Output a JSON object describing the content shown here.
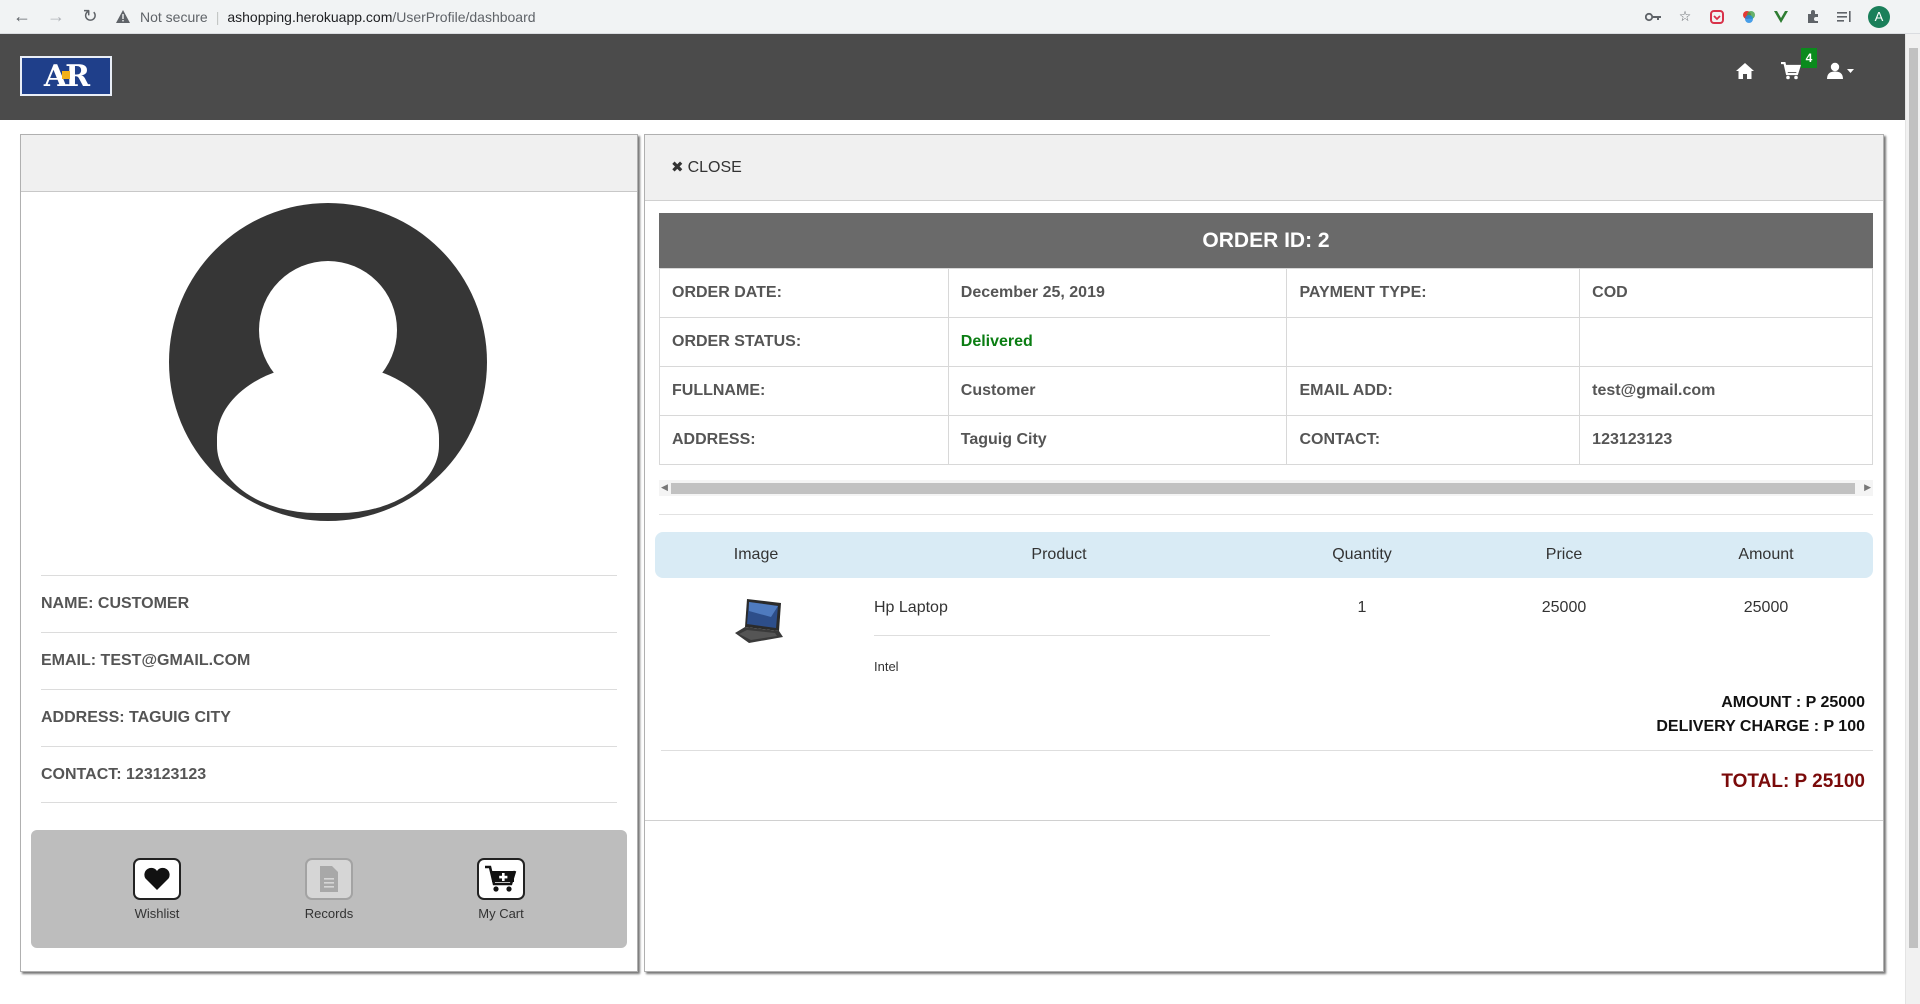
{
  "browser": {
    "security_label": "Not secure",
    "url_host": "ashopping.herokuapp.com",
    "url_path": "/UserProfile/dashboard",
    "profile_initial": "A"
  },
  "header": {
    "logo_text": "AR",
    "cart_count": "4",
    "colors": {
      "background": "#4b4b4b",
      "badge": "#0b8a1d"
    }
  },
  "profile": {
    "name": "NAME: CUSTOMER",
    "email": "EMAIL: TEST@GMAIL.COM",
    "address": "ADDRESS: TAGUIG CITY",
    "contact": "CONTACT: 123123123",
    "actions": {
      "wishlist": "Wishlist",
      "records": "Records",
      "cart": "My Cart"
    }
  },
  "order": {
    "close_label": "CLOSE",
    "title": "ORDER ID: 2",
    "details": {
      "order_date_label": "ORDER DATE:",
      "order_date": "December 25, 2019",
      "payment_type_label": "PAYMENT TYPE:",
      "payment_type": "COD",
      "order_status_label": "ORDER STATUS:",
      "order_status": "Delivered",
      "fullname_label": "FULLNAME:",
      "fullname": "Customer",
      "email_label": "EMAIL ADD:",
      "email": "test@gmail.com",
      "address_label": "ADDRESS:",
      "address": "Taguig City",
      "contact_label": "CONTACT:",
      "contact": "123123123"
    },
    "items_header": {
      "image": "Image",
      "product": "Product",
      "quantity": "Quantity",
      "price": "Price",
      "amount": "Amount"
    },
    "items": [
      {
        "name": "Hp Laptop",
        "description": "Intel",
        "quantity": "1",
        "price": "25000",
        "amount": "25000"
      }
    ],
    "amount_line": "AMOUNT : P 25000",
    "delivery_line": "DELIVERY CHARGE : P 100",
    "total_line": "TOTAL: P 25100",
    "colors": {
      "status": "#0a7d12",
      "total": "#7a0a0a",
      "title_bg": "#6a6a6a",
      "items_header_bg": "#d9ebf5"
    }
  }
}
